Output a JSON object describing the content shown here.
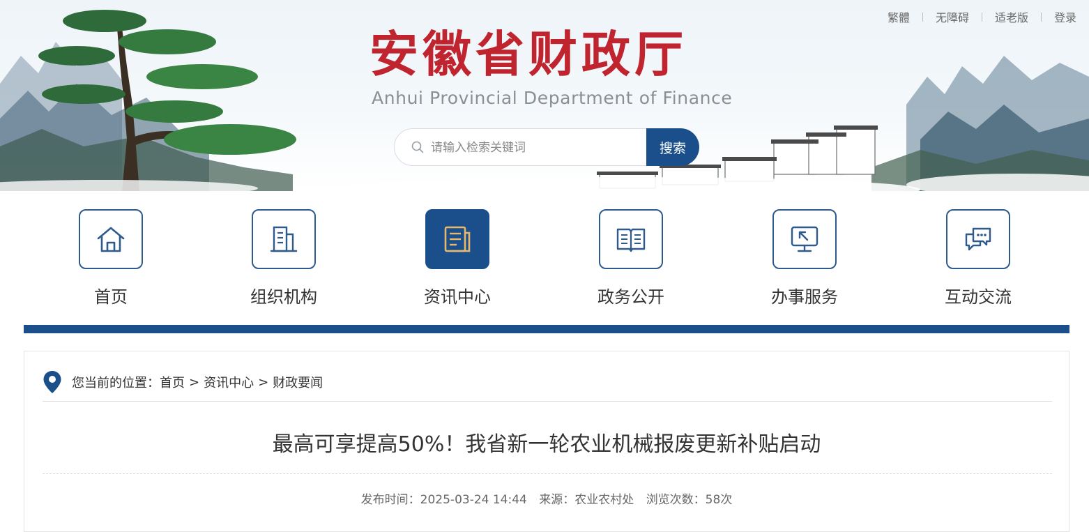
{
  "header": {
    "title": "安徽省财政厅",
    "subtitle": "Anhui Provincial Department of Finance",
    "top_links": [
      "繁體",
      "无障碍",
      "适老版",
      "登录"
    ],
    "search": {
      "placeholder": "请输入检索关键词",
      "button": "搜索"
    }
  },
  "nav": {
    "items": [
      {
        "label": "首页",
        "icon": "home-icon",
        "active": false
      },
      {
        "label": "组织机构",
        "icon": "building-icon",
        "active": false
      },
      {
        "label": "资讯中心",
        "icon": "news-icon",
        "active": true
      },
      {
        "label": "政务公开",
        "icon": "book-icon",
        "active": false
      },
      {
        "label": "办事服务",
        "icon": "monitor-icon",
        "active": false
      },
      {
        "label": "互动交流",
        "icon": "chat-icon",
        "active": false
      }
    ]
  },
  "breadcrumb": {
    "prefix": "您当前的位置：",
    "items": [
      "首页",
      "资讯中心",
      "财政要闻"
    ],
    "separator": ">"
  },
  "article": {
    "title": "最高可享提高50%！我省新一轮农业机械报废更新补贴启动",
    "publish_time": "发布时间：2025-03-24 14:44",
    "source": "来源：农业农村处",
    "views": "浏览次数：58次"
  },
  "colors": {
    "brand_blue": "#1b4f8c",
    "title_red": "#c0242f",
    "active_icon_accent": "#e8b86a"
  }
}
